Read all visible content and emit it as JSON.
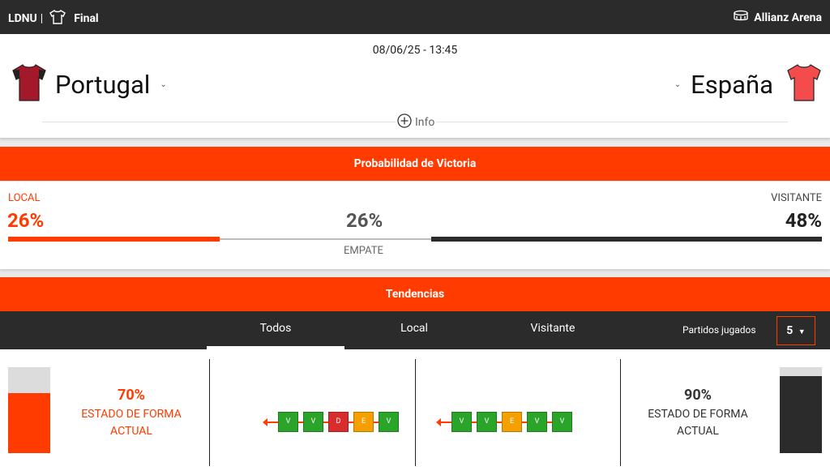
{
  "header": {
    "competition": "LDNU",
    "separator": "|",
    "stage": "Final",
    "venue": "Allianz Arena"
  },
  "match": {
    "datetime": "08/06/25 - 13:45",
    "home": {
      "name": "Portugal",
      "shirt_color": "#a3182a"
    },
    "away": {
      "name": "España",
      "shirt_color": "#f44c4c"
    },
    "info_label": "Info"
  },
  "probability": {
    "title": "Probabilidad de Victoria",
    "local_label": "LOCAL",
    "local_pct": "26%",
    "local_value": 26,
    "draw_pct": "26%",
    "draw_value": 26,
    "draw_label": "EMPATE",
    "away_label": "VISITANTE",
    "away_pct": "48%",
    "away_value": 48,
    "colors": {
      "local": "#ff3b00",
      "draw": "#bdbdbd",
      "away": "#2b2b2b"
    }
  },
  "trends": {
    "title": "Tendencias",
    "tabs": [
      "Todos",
      "Local",
      "Visitante"
    ],
    "active_tab": 0,
    "played_label": "Partidos jugados",
    "played_value": "5",
    "home_form": {
      "pct": "70%",
      "value": 70,
      "label_line1": "ESTADO DE FORMA",
      "label_line2": "ACTUAL",
      "results": [
        "V",
        "V",
        "D",
        "E",
        "V"
      ]
    },
    "away_form": {
      "pct": "90%",
      "value": 90,
      "label_line1": "ESTADO DE FORMA",
      "label_line2": "ACTUAL",
      "results": [
        "V",
        "V",
        "E",
        "V",
        "V"
      ]
    },
    "result_colors": {
      "V": "#2aa52a",
      "D": "#d92c2c",
      "E": "#f5a000"
    }
  },
  "colors": {
    "accent": "#ff3b00",
    "dark": "#2b2b2b"
  }
}
